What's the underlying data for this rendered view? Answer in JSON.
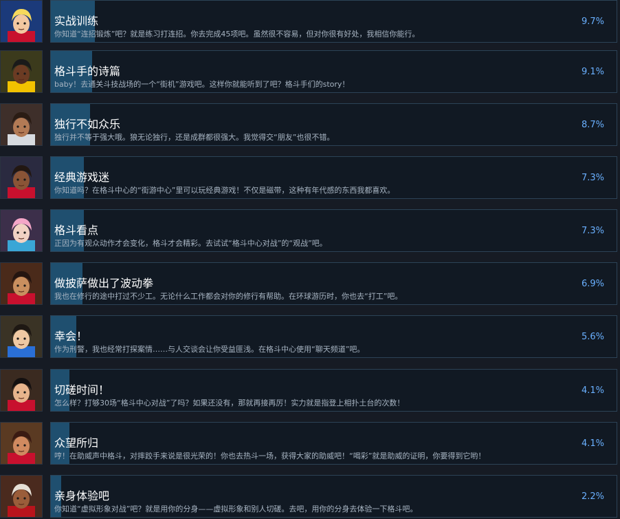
{
  "achievements": [
    {
      "title": "实战训练",
      "description": "你知道“连招锻炼”吧？就是练习打连招。你去完成45项吧。虽然很不容易，但对你很有好处，我相信你能行。",
      "percent_text": "9.7%",
      "percent": 9.7,
      "avatar": {
        "icon": "fighter-cammy-icon",
        "bg": "#1b3a7a",
        "skin": "#f2c7a0",
        "hair": "#f6d95c",
        "accent": "#c8102e"
      }
    },
    {
      "title": "格斗手的诗篇",
      "description": "baby！去通关斗技战场的一个“街机”游戏吧。这样你就能听到了吧？格斗手们的story！",
      "percent_text": "9.1%",
      "percent": 9.1,
      "avatar": {
        "icon": "fighter-deejay-icon",
        "bg": "#3b3a1c",
        "skin": "#6b3b23",
        "hair": "#1a1a1a",
        "accent": "#f2c200"
      }
    },
    {
      "title": "独行不如众乐",
      "description": "独行并不等于强大哦。狼无论独行，还是成群都很强大。我觉得交“朋友”也很不错。",
      "percent_text": "8.7%",
      "percent": 8.7,
      "avatar": {
        "icon": "fighter-lily-icon",
        "bg": "#3e2f2a",
        "skin": "#b27a55",
        "hair": "#2a1c14",
        "accent": "#d7dbe0"
      }
    },
    {
      "title": "经典游戏迷",
      "description": "你知道吗？在格斗中心的“街游中心”里可以玩经典游戏！不仅是磁带，这种有年代感的东西我都喜欢。",
      "percent_text": "7.3%",
      "percent": 7.3,
      "avatar": {
        "icon": "fighter-kimberly-icon",
        "bg": "#2a2a40",
        "skin": "#8a5436",
        "hair": "#221712",
        "accent": "#c8102e"
      }
    },
    {
      "title": "格斗看点",
      "description": "正因为有观众动作才会变化，格斗才会精彩。去试试“格斗中心对战”的“观战”吧。",
      "percent_text": "7.3%",
      "percent": 7.3,
      "avatar": {
        "icon": "fighter-manon-icon",
        "bg": "#3c2f4a",
        "skin": "#f1d2c3",
        "hair": "#f4a6c8",
        "accent": "#3aa6d6"
      }
    },
    {
      "title": "做披萨做出了波动拳",
      "description": "我也在修行的途中打过不少工。无论什么工作都会对你的修行有帮助。在环球游历时，你也去“打工”吧。",
      "percent_text": "6.9%",
      "percent": 6.9,
      "avatar": {
        "icon": "fighter-ryu-icon",
        "bg": "#4a2a1a",
        "skin": "#c98f5f",
        "hair": "#241510",
        "accent": "#c8102e"
      }
    },
    {
      "title": "幸会！",
      "description": "作为刑警，我也经常打探案情……与人交谈会让你受益匪浅。在格斗中心使用“聊天频道”吧。",
      "percent_text": "5.6%",
      "percent": 5.6,
      "avatar": {
        "icon": "fighter-chunli-icon",
        "bg": "#3a3325",
        "skin": "#f0c9a3",
        "hair": "#1e1813",
        "accent": "#2a6fd6"
      }
    },
    {
      "title": "切磋时间！",
      "description": "怎么样？打够30场“格斗中心对战”了吗？如果还没有，那就再接再厉！实力就是指登上相扑土台的次数！",
      "percent_text": "4.1%",
      "percent": 4.1,
      "avatar": {
        "icon": "fighter-ehonda-icon",
        "bg": "#3a2a20",
        "skin": "#e7b48c",
        "hair": "#141010",
        "accent": "#c8102e"
      }
    },
    {
      "title": "众望所归",
      "description": "哼！在助威声中格斗，对摔跤手来说是很光荣的！你也去热斗一场，获得大家的助威吧！“喝彩”就是助威的证明，你要得到它哟！",
      "percent_text": "4.1%",
      "percent": 4.1,
      "avatar": {
        "icon": "fighter-zangief-icon",
        "bg": "#5a3a22",
        "skin": "#d08a60",
        "hair": "#3a1a12",
        "accent": "#c8102e"
      }
    },
    {
      "title": "亲身体验吧",
      "description": "你知道“虚拟形象对战”吧？就是用你的分身——虚拟形象和别人切磋。去吧，用你的分身去体验一下格斗吧。",
      "percent_text": "2.2%",
      "percent": 2.2,
      "avatar": {
        "icon": "fighter-dhalsim-icon",
        "bg": "#4a2a1e",
        "skin": "#9a5d3a",
        "hair": "#e6e0d6",
        "accent": "#b8141c"
      }
    }
  ]
}
